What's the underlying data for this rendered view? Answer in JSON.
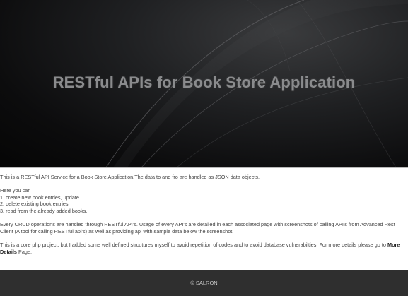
{
  "hero": {
    "title": "RESTful APIs for Book Store Application"
  },
  "content": {
    "intro": "This is a RESTful API Service for a Book Store Application.The data to and fro are handled as JSON data objects.",
    "list_heading": "Here you can",
    "list_items": [
      "1. create new book entries, update",
      "2. delete existing book entries",
      "3. read from the already added books."
    ],
    "crud_paragraph": "Every CRUD operations are handled through RESTful API's. Usage of every API's are detailed in each associated page with screenshots of calling API's from Advanced Rest Client (A tool for calling RESTful api's) as well as providing api with sample data below the screenshot.",
    "core_paragraph_prefix": "This is a core php project, but I added some well defined strcutures myself to avoid repetition of codes and to avoid database vulnerabilties. For more details please go to ",
    "more_details_link": "More Details",
    "core_paragraph_suffix": " Page."
  },
  "footer": {
    "copyright": "© SALRON"
  },
  "colors": {
    "hero_background": "#1a1a1b",
    "hero_title": "#8a8b8d",
    "body_text": "#444444",
    "footer_background": "#2f2f2f",
    "footer_text": "#c9c9c9"
  }
}
